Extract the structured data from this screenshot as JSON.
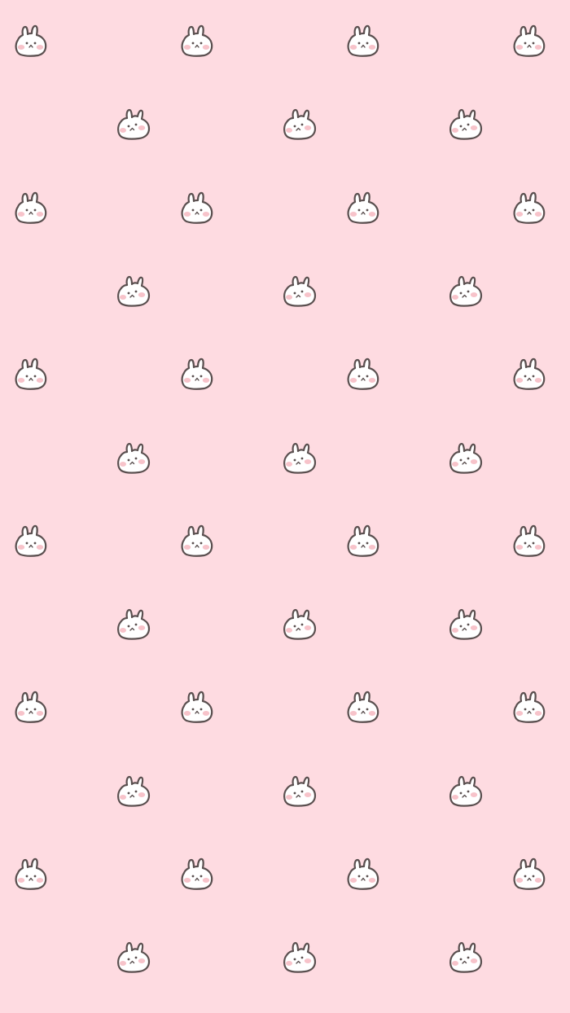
{
  "wallpaper": {
    "background_color": "#fedbe1",
    "pattern_icon": "bunny-face-icon",
    "icon_body_color": "#ffffff",
    "icon_outline_color": "#5a4f4f",
    "icon_blush_color": "#f7c3ca"
  }
}
